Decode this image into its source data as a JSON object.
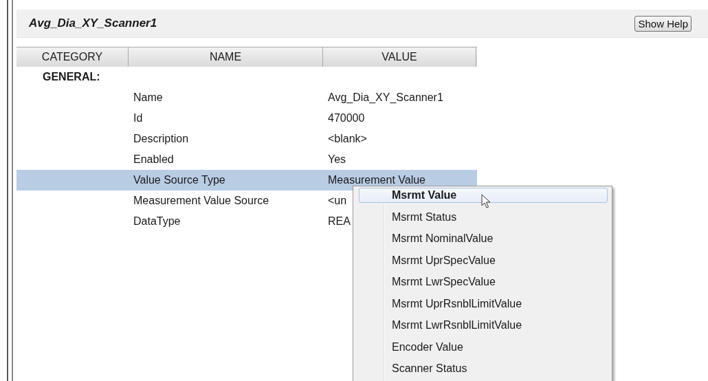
{
  "header": {
    "title": "Avg_Dia_XY_Scanner1",
    "help_button": "Show Help"
  },
  "table": {
    "columns": [
      "CATEGORY",
      "NAME",
      "VALUE"
    ],
    "category": "GENERAL:",
    "rows": [
      {
        "name": "Name",
        "value": "Avg_Dia_XY_Scanner1",
        "selected": false
      },
      {
        "name": "Id",
        "value": "470000",
        "selected": false
      },
      {
        "name": "Description",
        "value": "<blank>",
        "selected": false
      },
      {
        "name": "Enabled",
        "value": "Yes",
        "selected": false
      },
      {
        "name": "Value Source Type",
        "value": "Measurement Value",
        "selected": true
      },
      {
        "name": "Measurement Value Source",
        "value": "<un",
        "selected": false
      },
      {
        "name": "DataType",
        "value": "REA",
        "selected": false
      }
    ]
  },
  "dropdown_menu": {
    "items": [
      {
        "label": "Msrmt Value",
        "selected": true
      },
      {
        "label": "Msrmt Status",
        "selected": false
      },
      {
        "label": "Msrmt NominalValue",
        "selected": false
      },
      {
        "label": "Msrmt UprSpecValue",
        "selected": false
      },
      {
        "label": "Msrmt LwrSpecValue",
        "selected": false
      },
      {
        "label": "Msrmt UprRsnblLimitValue",
        "selected": false
      },
      {
        "label": "Msrmt LwrRsnblLimitValue",
        "selected": false
      },
      {
        "label": "Encoder Value",
        "selected": false
      },
      {
        "label": "Scanner Status",
        "selected": false
      }
    ]
  }
}
